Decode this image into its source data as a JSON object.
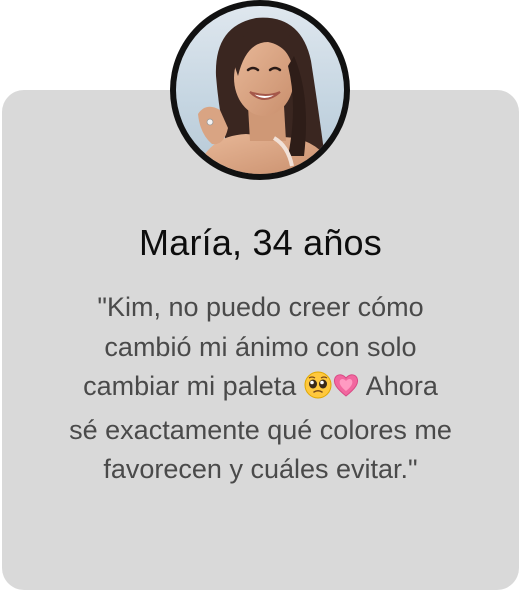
{
  "testimonial": {
    "name": "María, 34 años",
    "quote_line1": "\"Kim, no puedo creer cómo",
    "quote_line2": "cambió mi ánimo con solo",
    "quote_line3_start": "cambiar mi paleta",
    "quote_line3_end": "Ahora",
    "quote_line4": "sé exactamente qué colores me",
    "quote_line5": "favorecen y cuáles evitar.\"",
    "emojis": [
      "pleading-face-icon",
      "growing-heart-icon"
    ]
  },
  "colors": {
    "card_background": "#d9d9d9",
    "avatar_border": "#111111",
    "name_text": "#0d0d0d",
    "quote_text": "#4a4a4a"
  }
}
